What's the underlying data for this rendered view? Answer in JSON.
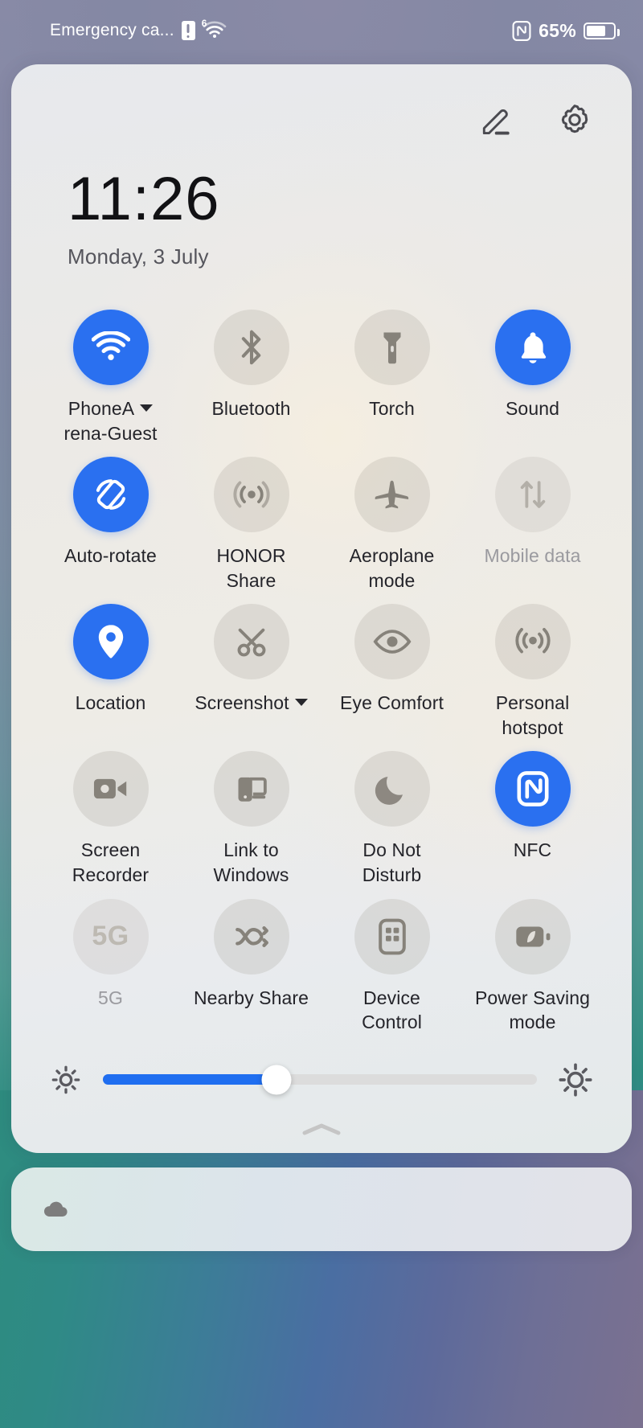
{
  "statusbar": {
    "carrier": "Emergency ca...",
    "sim_icon": "sim-warning-icon",
    "wifi_icon": "wifi-6-icon",
    "wifi_generation": "6",
    "nfc_icon": "nfc-icon",
    "battery_percent": "65%",
    "battery_icon": "battery-icon",
    "battery_level": 65
  },
  "panel": {
    "edit_icon": "edit-pencil-icon",
    "settings_icon": "gear-icon",
    "clock": "11:26",
    "date": "Monday, 3 July",
    "accent_color": "#2a70f0",
    "inactive_color": "#96918722"
  },
  "tiles": [
    {
      "id": "wifi",
      "label": "PhoneArena-Guest",
      "label_lines": [
        "PhoneA",
        "rena-Guest"
      ],
      "icon": "wifi-icon",
      "state": "on",
      "has_caret": true
    },
    {
      "id": "bluetooth",
      "label": "Bluetooth",
      "label_lines": [
        "Bluetooth"
      ],
      "icon": "bluetooth-icon",
      "state": "off",
      "has_caret": false
    },
    {
      "id": "torch",
      "label": "Torch",
      "label_lines": [
        "Torch"
      ],
      "icon": "torch-icon",
      "state": "off",
      "has_caret": false
    },
    {
      "id": "sound",
      "label": "Sound",
      "label_lines": [
        "Sound"
      ],
      "icon": "bell-icon",
      "state": "on",
      "has_caret": false
    },
    {
      "id": "auto-rotate",
      "label": "Auto-rotate",
      "label_lines": [
        "Auto-rotate"
      ],
      "icon": "auto-rotate-icon",
      "state": "on",
      "has_caret": false
    },
    {
      "id": "honor-share",
      "label": "HONOR Share",
      "label_lines": [
        "HONOR",
        "Share"
      ],
      "icon": "honor-share-icon",
      "state": "off",
      "has_caret": false
    },
    {
      "id": "aeroplane-mode",
      "label": "Aeroplane mode",
      "label_lines": [
        "Aeroplane",
        "mode"
      ],
      "icon": "aeroplane-icon",
      "state": "off",
      "has_caret": false
    },
    {
      "id": "mobile-data",
      "label": "Mobile data",
      "label_lines": [
        "Mobile data"
      ],
      "icon": "mobile-data-icon",
      "state": "disabled",
      "has_caret": false
    },
    {
      "id": "location",
      "label": "Location",
      "label_lines": [
        "Location"
      ],
      "icon": "location-pin-icon",
      "state": "on",
      "has_caret": false
    },
    {
      "id": "screenshot",
      "label": "Screenshot",
      "label_lines": [
        "Screenshot"
      ],
      "icon": "screenshot-icon",
      "state": "off",
      "has_caret": true
    },
    {
      "id": "eye-comfort",
      "label": "Eye Comfort",
      "label_lines": [
        "Eye Comfort"
      ],
      "icon": "eye-icon",
      "state": "off",
      "has_caret": false
    },
    {
      "id": "personal-hotspot",
      "label": "Personal hotspot",
      "label_lines": [
        "Personal",
        "hotspot"
      ],
      "icon": "hotspot-icon",
      "state": "off",
      "has_caret": false
    },
    {
      "id": "screen-recorder",
      "label": "Screen Recorder",
      "label_lines": [
        "Screen",
        "Recorder"
      ],
      "icon": "video-camera-icon",
      "state": "off",
      "has_caret": false
    },
    {
      "id": "link-to-windows",
      "label": "Link to Windows",
      "label_lines": [
        "Link to",
        "Windows"
      ],
      "icon": "link-to-windows-icon",
      "state": "off",
      "has_caret": false
    },
    {
      "id": "do-not-disturb",
      "label": "Do Not Disturb",
      "label_lines": [
        "Do Not",
        "Disturb"
      ],
      "icon": "moon-icon",
      "state": "off",
      "has_caret": false
    },
    {
      "id": "nfc",
      "label": "NFC",
      "label_lines": [
        "NFC"
      ],
      "icon": "nfc-icon",
      "state": "on",
      "has_caret": false
    },
    {
      "id": "5g",
      "label": "5G",
      "label_lines": [
        "5G"
      ],
      "icon": "5g-icon",
      "state": "disabled",
      "has_caret": false
    },
    {
      "id": "nearby-share",
      "label": "Nearby Share",
      "label_lines": [
        "Nearby Share"
      ],
      "icon": "nearby-share-icon",
      "state": "off",
      "has_caret": false
    },
    {
      "id": "device-control",
      "label": "Device Control",
      "label_lines": [
        "Device",
        "Control"
      ],
      "icon": "device-control-icon",
      "state": "off",
      "has_caret": false
    },
    {
      "id": "power-saving",
      "label": "Power Saving mode",
      "label_lines": [
        "Power Saving",
        "mode"
      ],
      "icon": "power-saving-icon",
      "state": "off",
      "has_caret": false
    }
  ],
  "brightness": {
    "low_icon": "brightness-low-icon",
    "high_icon": "brightness-high-icon",
    "value": 40
  },
  "handle": {
    "icon": "chevron-up-icon"
  },
  "notification": {
    "icon": "cloud-icon"
  }
}
